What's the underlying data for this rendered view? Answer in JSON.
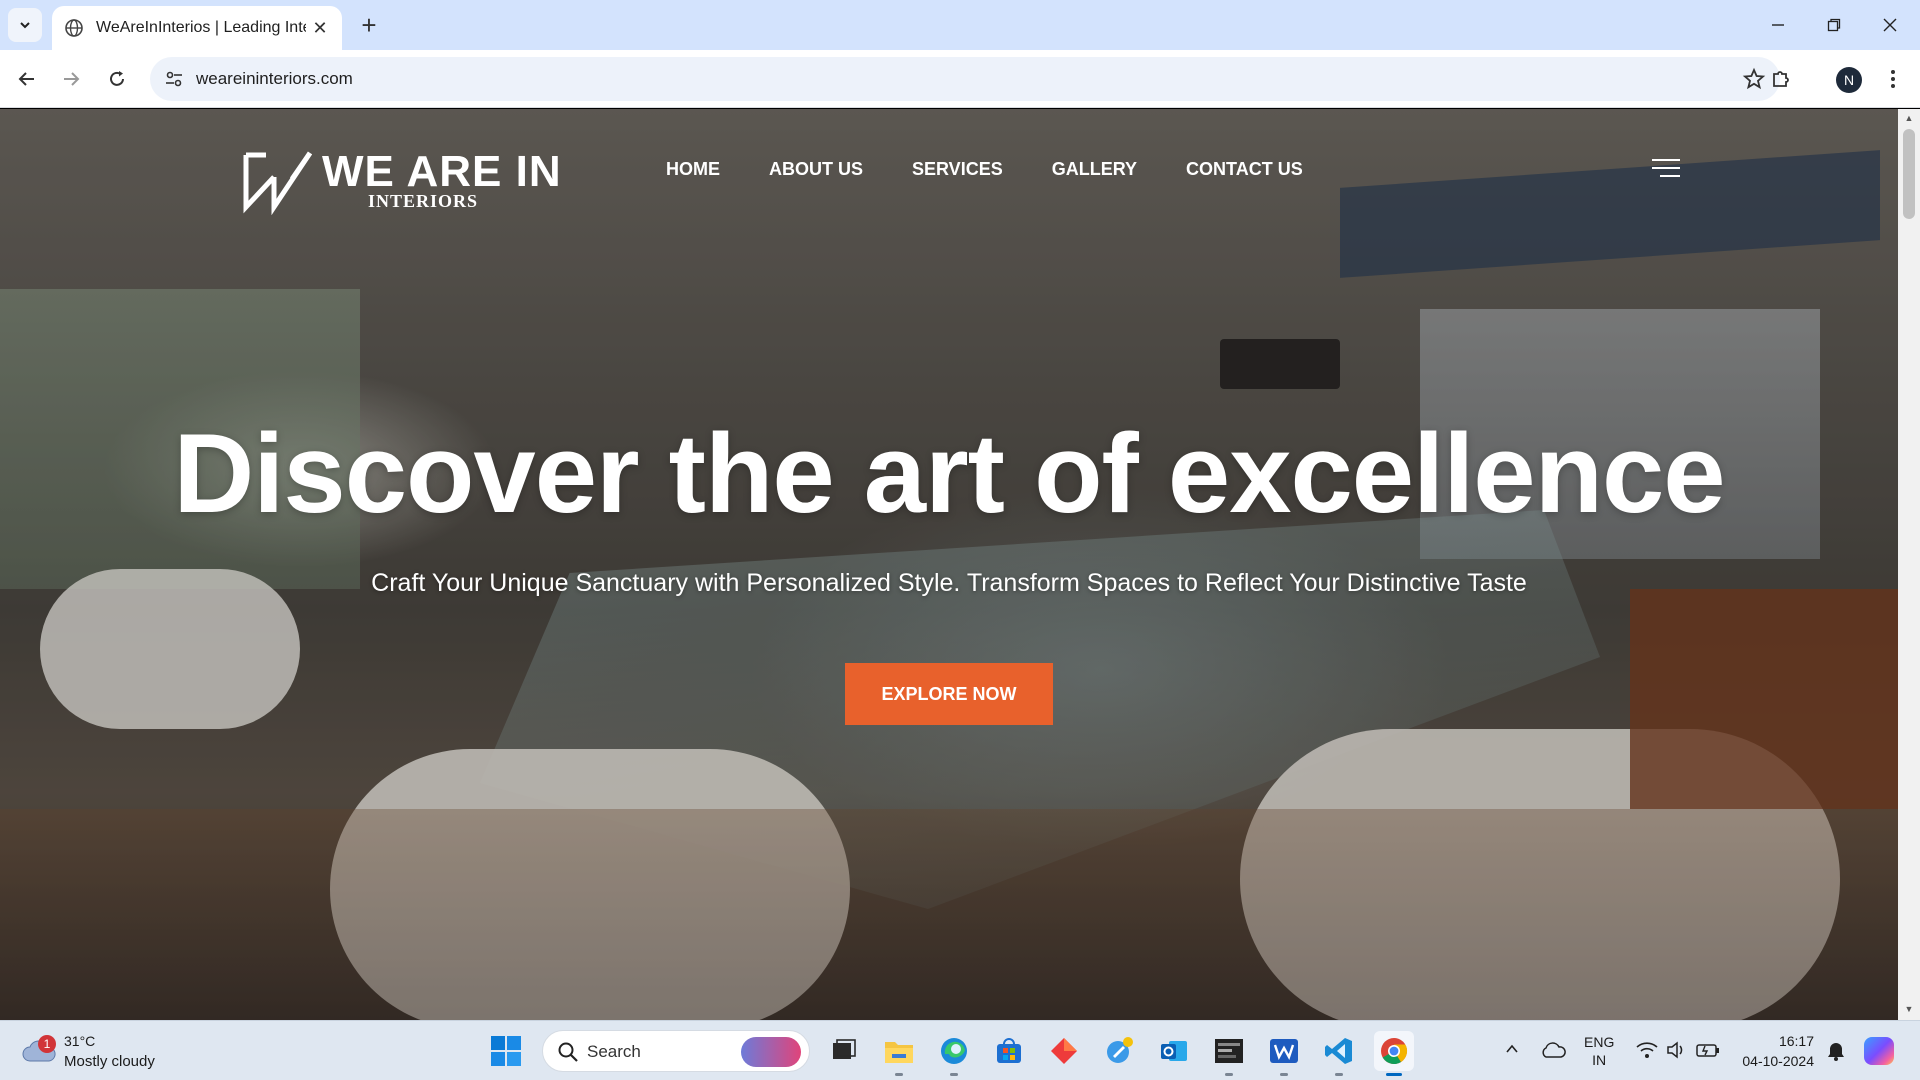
{
  "browser": {
    "tab_title": "WeAreInInterios | Leading Interior Designers",
    "url": "weareininteriors.com",
    "profile_initial": "N"
  },
  "site": {
    "logo_main": "WE ARE IN",
    "logo_sub": "INTERIORS",
    "nav": [
      "HOME",
      "ABOUT US",
      "SERVICES",
      "GALLERY",
      "CONTACT US"
    ],
    "hero_title": "Discover the art of excellence",
    "hero_subtitle": "Craft Your Unique Sanctuary with Personalized Style. Transform Spaces to Reflect Your Distinctive Taste",
    "cta_label": "EXPLORE NOW",
    "accent_color": "#e8612c"
  },
  "taskbar": {
    "weather": {
      "temp": "31°C",
      "condition": "Mostly cloudy",
      "badge": "1"
    },
    "search_label": "Search",
    "apps": [
      "file-explorer",
      "task-view",
      "edge",
      "microsoft-store",
      "figma-like",
      "copilot",
      "outlook",
      "terminal",
      "word",
      "vscode",
      "chrome"
    ],
    "language_line1": "ENG",
    "language_line2": "IN",
    "time": "16:17",
    "date": "04-10-2024"
  }
}
